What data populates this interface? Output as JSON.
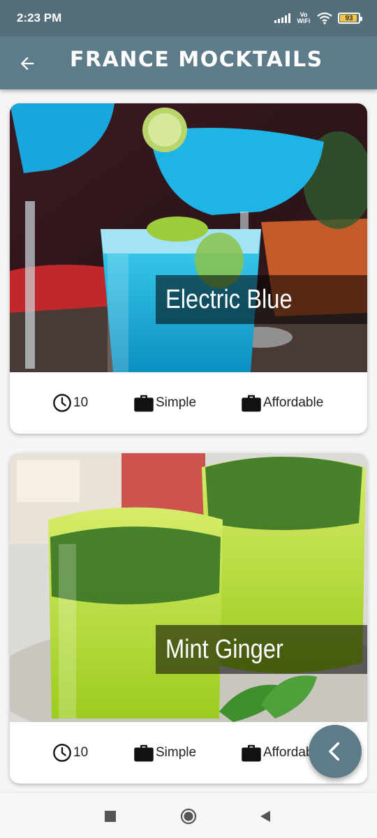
{
  "status_bar": {
    "time": "2:23 PM",
    "network_label": "Vo WiFi",
    "battery_level": "93",
    "battery_fraction": 0.93
  },
  "app_bar": {
    "title": "France Mocktails",
    "back_icon": "arrow-left-icon"
  },
  "recipes": [
    {
      "title": "Electric Blue",
      "duration": "10",
      "complexity": "Simple",
      "affordability": "Affordable",
      "image": "blue-cocktail-photo"
    },
    {
      "title": "Mint Ginger",
      "duration": "10",
      "complexity": "Simple",
      "affordability": "Affordable",
      "image": "mint-lime-drink-photo"
    }
  ],
  "icons": {
    "duration": "clock-icon",
    "complexity": "briefcase-icon",
    "affordability": "briefcase-icon",
    "fab": "chevron-left-icon"
  },
  "colors": {
    "status_bar": "#546e7a",
    "app_bar": "#5d7b88",
    "fab": "#5d7b88",
    "title_overlay": "rgba(0,0,0,0.55)"
  },
  "nav": {
    "recents": "square-icon",
    "home": "circle-icon",
    "back": "triangle-back-icon"
  }
}
